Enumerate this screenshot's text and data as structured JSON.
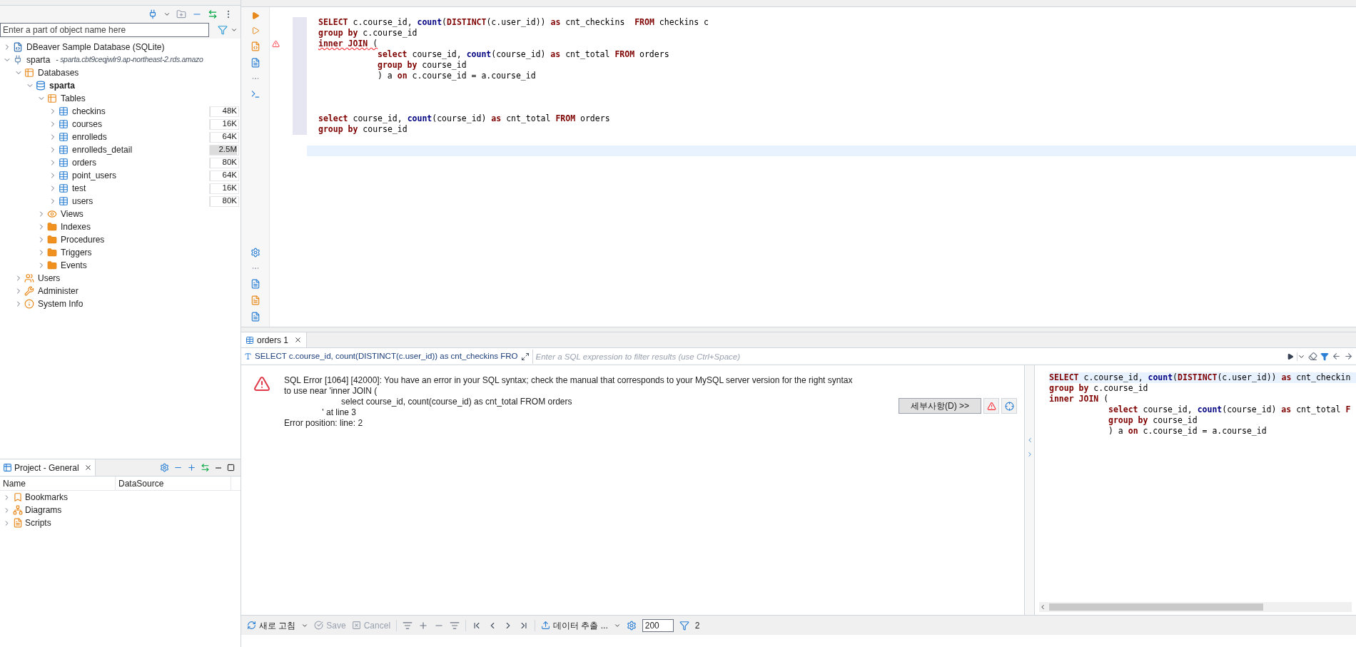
{
  "navigator": {
    "filter": {
      "placeholder": "Enter a part of object name here"
    },
    "tree": [
      {
        "label": "DBeaver Sample Database (SQLite)",
        "kind": "sqlite",
        "expanded": false
      },
      {
        "label": "sparta",
        "note": "- sparta.cbt9ceqjwlr9.ap-northeast-2.rds.amazo",
        "kind": "connection",
        "expanded": true,
        "children": [
          {
            "label": "Databases",
            "kind": "databases",
            "expanded": true,
            "children": [
              {
                "label": "sparta",
                "kind": "database",
                "bold": true,
                "expanded": true,
                "children": [
                  {
                    "label": "Tables",
                    "kind": "tables",
                    "expanded": true,
                    "children": [
                      {
                        "label": "checkins",
                        "kind": "table",
                        "expanded": false,
                        "size": "48K",
                        "level": 0.02
                      },
                      {
                        "label": "courses",
                        "kind": "table",
                        "expanded": false,
                        "size": "16K",
                        "level": 0.01
                      },
                      {
                        "label": "enrolleds",
                        "kind": "table",
                        "expanded": false,
                        "size": "64K",
                        "level": 0.02
                      },
                      {
                        "label": "enrolleds_detail",
                        "kind": "table",
                        "expanded": false,
                        "size": "2.5M",
                        "level": 0.95
                      },
                      {
                        "label": "orders",
                        "kind": "table",
                        "expanded": false,
                        "size": "80K",
                        "level": 0.03
                      },
                      {
                        "label": "point_users",
                        "kind": "table",
                        "expanded": false,
                        "size": "64K",
                        "level": 0.02
                      },
                      {
                        "label": "test",
                        "kind": "table",
                        "expanded": false,
                        "size": "16K",
                        "level": 0.01
                      },
                      {
                        "label": "users",
                        "kind": "table",
                        "expanded": false,
                        "size": "80K",
                        "level": 0.03
                      }
                    ]
                  },
                  {
                    "label": "Views",
                    "kind": "views",
                    "expanded": false
                  },
                  {
                    "label": "Indexes",
                    "kind": "folder",
                    "expanded": false
                  },
                  {
                    "label": "Procedures",
                    "kind": "folder",
                    "expanded": false
                  },
                  {
                    "label": "Triggers",
                    "kind": "folder",
                    "expanded": false
                  },
                  {
                    "label": "Events",
                    "kind": "folder",
                    "expanded": false
                  }
                ]
              }
            ]
          },
          {
            "label": "Users",
            "kind": "users",
            "expanded": false
          },
          {
            "label": "Administer",
            "kind": "administer",
            "expanded": false
          },
          {
            "label": "System Info",
            "kind": "info",
            "expanded": false
          }
        ]
      }
    ]
  },
  "project": {
    "title": "Project - General",
    "columns": [
      "Name",
      "DataSource"
    ],
    "items": [
      {
        "label": "Bookmarks",
        "kind": "bookmarks"
      },
      {
        "label": "Diagrams",
        "kind": "diagrams"
      },
      {
        "label": "Scripts",
        "kind": "scripts"
      }
    ]
  },
  "editor": {
    "current_line_highlight": true,
    "statements": [
      {
        "lines": [
          {
            "indent": false,
            "error": false,
            "tokens": [
              {
                "kind": "keyword",
                "text": "SELECT"
              },
              {
                "kind": "plain",
                "text": " c.course_id, "
              },
              {
                "kind": "function",
                "text": "count"
              },
              {
                "kind": "plain",
                "text": "("
              },
              {
                "kind": "keyword",
                "text": "DISTINCT"
              },
              {
                "kind": "plain",
                "text": "(c.user_id)) "
              },
              {
                "kind": "keyword",
                "text": "as"
              },
              {
                "kind": "plain",
                "text": " cnt_checkins  "
              },
              {
                "kind": "keyword",
                "text": "FROM"
              },
              {
                "kind": "plain",
                "text": " checkins c"
              }
            ]
          },
          {
            "indent": false,
            "error": false,
            "tokens": [
              {
                "kind": "keyword",
                "text": "group by"
              },
              {
                "kind": "plain",
                "text": " c.course_id"
              }
            ]
          },
          {
            "indent": false,
            "error": true,
            "tokens": [
              {
                "kind": "keyword",
                "text": "inner JOIN"
              },
              {
                "kind": "plain",
                "text": " ("
              }
            ]
          },
          {
            "indent": true,
            "error": false,
            "tokens": [
              {
                "kind": "keyword",
                "text": "select"
              },
              {
                "kind": "plain",
                "text": " course_id, "
              },
              {
                "kind": "function",
                "text": "count"
              },
              {
                "kind": "plain",
                "text": "(course_id) "
              },
              {
                "kind": "keyword",
                "text": "as"
              },
              {
                "kind": "plain",
                "text": " cnt_total "
              },
              {
                "kind": "keyword",
                "text": "FROM"
              },
              {
                "kind": "plain",
                "text": " orders"
              }
            ]
          },
          {
            "indent": true,
            "error": false,
            "tokens": [
              {
                "kind": "keyword",
                "text": "group by"
              },
              {
                "kind": "plain",
                "text": " course_id"
              }
            ]
          },
          {
            "indent": true,
            "error": false,
            "tokens": [
              {
                "kind": "plain",
                "text": ") a "
              },
              {
                "kind": "keyword",
                "text": "on"
              },
              {
                "kind": "plain",
                "text": " c.course_id = a.course_id"
              }
            ]
          }
        ]
      },
      {
        "lines": [
          {
            "indent": false,
            "error": false,
            "tokens": [
              {
                "kind": "keyword",
                "text": "select"
              },
              {
                "kind": "plain",
                "text": " course_id, "
              },
              {
                "kind": "function",
                "text": "count"
              },
              {
                "kind": "plain",
                "text": "(course_id) "
              },
              {
                "kind": "keyword",
                "text": "as"
              },
              {
                "kind": "plain",
                "text": " cnt_total "
              },
              {
                "kind": "keyword",
                "text": "FROM"
              },
              {
                "kind": "plain",
                "text": " orders"
              }
            ]
          },
          {
            "indent": false,
            "error": false,
            "tokens": [
              {
                "kind": "keyword",
                "text": "group by"
              },
              {
                "kind": "plain",
                "text": " course_id"
              }
            ]
          }
        ]
      }
    ]
  },
  "results": {
    "tab": {
      "label": "orders 1",
      "selected": true
    },
    "query": "SELECT c.course_id, count(DISTINCT(c.user_id)) as cnt_checkins FRO",
    "filter": {
      "placeholder": "Enter a SQL expression to filter results (use Ctrl+Space)"
    },
    "error": {
      "message": "SQL Error [1064] [42000]: You have an error in your SQL syntax; check the manual that corresponds to your MySQL server version for the right syntax\nto use near 'inner JOIN (\n                        select course_id, count(course_id) as cnt_total FROM orders\n                ' at line 3\nError position: line: 2",
      "details_button": "세부사항(D) >>"
    },
    "side_query": [
      {
        "indent": false,
        "current": true,
        "tokens": [
          {
            "kind": "keyword",
            "text": "SELECT"
          },
          {
            "kind": "plain",
            "text": " c.course_id, "
          },
          {
            "kind": "function",
            "text": "count"
          },
          {
            "kind": "plain",
            "text": "("
          },
          {
            "kind": "keyword",
            "text": "DISTINCT"
          },
          {
            "kind": "plain",
            "text": "(c.user_id)) "
          },
          {
            "kind": "keyword",
            "text": "as"
          },
          {
            "kind": "plain",
            "text": " cnt_checkin"
          }
        ]
      },
      {
        "indent": false,
        "current": false,
        "tokens": [
          {
            "kind": "keyword",
            "text": "group by"
          },
          {
            "kind": "plain",
            "text": " c.course_id"
          }
        ]
      },
      {
        "indent": false,
        "current": false,
        "tokens": [
          {
            "kind": "keyword",
            "text": "inner JOIN"
          },
          {
            "kind": "plain",
            "text": " ("
          }
        ]
      },
      {
        "indent": true,
        "current": false,
        "tokens": [
          {
            "kind": "keyword",
            "text": "select"
          },
          {
            "kind": "plain",
            "text": " course_id, "
          },
          {
            "kind": "function",
            "text": "count"
          },
          {
            "kind": "plain",
            "text": "(course_id) "
          },
          {
            "kind": "keyword",
            "text": "as"
          },
          {
            "kind": "plain",
            "text": " cnt_total "
          },
          {
            "kind": "keyword",
            "text": "F"
          }
        ]
      },
      {
        "indent": true,
        "current": false,
        "tokens": [
          {
            "kind": "keyword",
            "text": "group by"
          },
          {
            "kind": "plain",
            "text": " course_id"
          }
        ]
      },
      {
        "indent": true,
        "current": false,
        "tokens": [
          {
            "kind": "plain",
            "text": ") a "
          },
          {
            "kind": "keyword",
            "text": "on"
          },
          {
            "kind": "plain",
            "text": " c.course_id = a.course_id"
          }
        ]
      }
    ],
    "toolbar": {
      "refresh": "새로 고침",
      "save": {
        "label": "Save",
        "disabled": true
      },
      "cancel": {
        "label": "Cancel",
        "disabled": true
      },
      "export": "데이터 추출 ...",
      "fetch_size": "200",
      "count": "2"
    }
  }
}
